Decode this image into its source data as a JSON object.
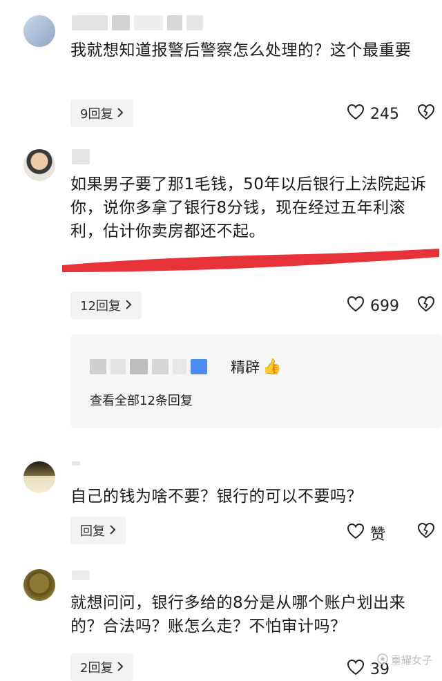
{
  "comments": [
    {
      "text": "我就想知道报警后警察怎么处理的？这个最重要",
      "reply_label": "9回复",
      "likes": "245"
    },
    {
      "text": "如果男子要了那1毛钱，50年以后银行上法院起诉你，说你多拿了银行8分钱，现在经过五年利滚利，估计你卖房都还不起。",
      "reply_label": "12回复",
      "likes": "699",
      "sub_reply": {
        "text": "精辟",
        "emoji": "👍",
        "view_all": "查看全部12条回复"
      }
    },
    {
      "text": "自己的钱为啥不要？银行的可以不要吗？",
      "reply_label": "回复",
      "likes": "赞"
    },
    {
      "text": "就想问问，银行多给的8分是从哪个账户划出来的？合法吗？账怎么走？不怕审计吗？",
      "reply_label": "2回复",
      "likes": "39"
    }
  ],
  "watermark": "重耀女子",
  "colors": {
    "underline": "#e8323a",
    "reply_bg": "#f2f3f5",
    "card_bg": "#f5f6f8"
  },
  "icons": [
    "heart-icon",
    "broken-heart-icon",
    "chevron-right-icon",
    "thumbs-up-emoji"
  ]
}
